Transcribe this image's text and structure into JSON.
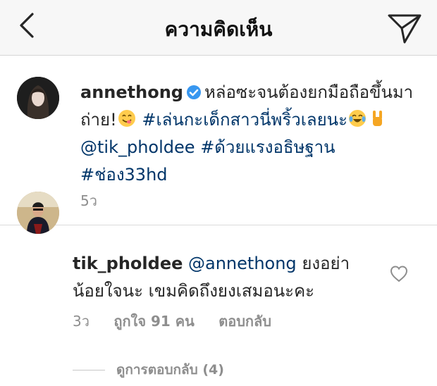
{
  "header": {
    "title": "ความคิดเห็น",
    "back_icon": "chevron-left-icon",
    "send_icon": "paper-plane-icon"
  },
  "caption": {
    "username": "annethong",
    "text_part1": "หล่อซะจนต้องยกมือถือขึ้นมาถ่าย!",
    "emoji1": "face-savoring-food-emoji",
    "tag1": "#เล่นกะเด็กสาวนี่พริ้วเลยนะ",
    "emoji2": "tears-of-joy-emoji",
    "emoji3": "rock-on-hand-emoji",
    "mention": "@tik_pholdee",
    "tag2": "#ด้วยแรงอธิษฐาน",
    "tag3": "#ช่อง33hd",
    "time": "5ว"
  },
  "comment": {
    "username": "tik_pholdee",
    "mention": "@annethong",
    "text": "ยงอย่าน้อยใจนะ เขมคิดถึงยงเสมอนะคะ",
    "time": "3ว",
    "likes": "ถูกใจ 91 คน",
    "reply_label": "ตอบกลับ",
    "view_replies": "ดูการตอบกลับ (4)"
  },
  "colors": {
    "link": "#003569",
    "meta": "#8e8e8e",
    "verified": "#3897f0",
    "header_bg": "#f7f7f7"
  }
}
